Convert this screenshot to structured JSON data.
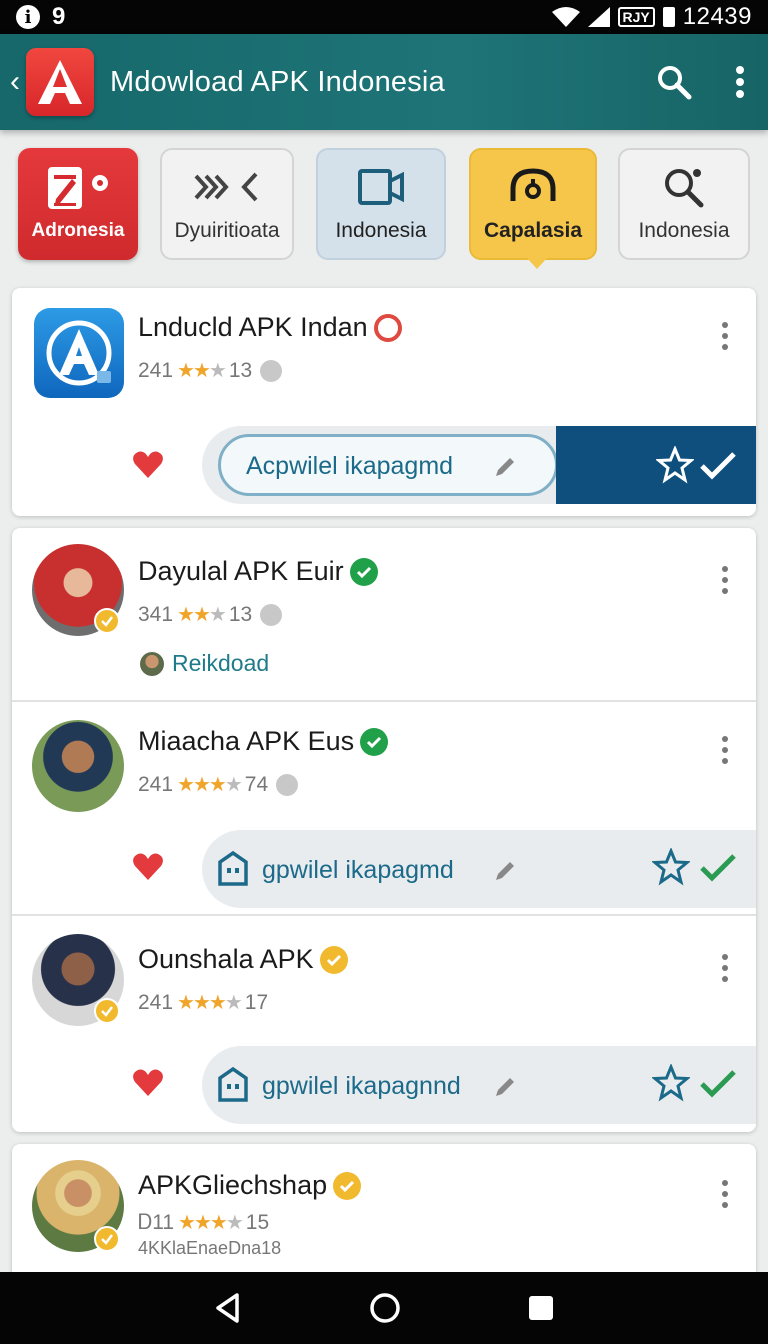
{
  "status_bar": {
    "left_glyph_1": "i",
    "left_glyph_2": "9",
    "network_badge": "RJY",
    "time": "12439"
  },
  "app_bar": {
    "title": "Mdowload APK Indonesia",
    "back_glyph": "‹",
    "logo_letter": "A"
  },
  "categories": [
    {
      "label": "Adronesia",
      "icon": "edit-settings-icon"
    },
    {
      "label": "Dyuiritioata",
      "icon": "chevrons-icon"
    },
    {
      "label": "Indonesia",
      "icon": "video-camera-icon"
    },
    {
      "label": "Capalasia",
      "icon": "headset-icon",
      "selected": true
    },
    {
      "label": "Indonesia",
      "icon": "magnifier-icon"
    }
  ],
  "items": [
    {
      "title": "Lnducld APK Indan",
      "rating_left": "241",
      "stars": 2,
      "rating_right": "13",
      "field_text": "Acpwilel ikapagmd"
    },
    {
      "title": "Dayulal APK Euir",
      "rating_left": "341",
      "stars": 2,
      "rating_right": "13",
      "link_text": "Reikdoad"
    },
    {
      "title": "Miaacha APK Eus",
      "rating_left": "241",
      "stars": 3,
      "rating_right": "74",
      "field_text": "gpwilel ikapagmd"
    },
    {
      "title": "Ounshala APK",
      "rating_left": "241",
      "stars": 3,
      "rating_right": "17",
      "field_text": "gpwilel ikapagnnd"
    },
    {
      "title": "APKGliechshap",
      "rating_left": "Ꭰ11",
      "stars": 3,
      "rating_right": "15",
      "subtitle": "4KKlaEnaeDna18"
    }
  ],
  "colors": {
    "app_bar": "#1e7477",
    "accent_red": "#e5393c",
    "accent_yellow": "#f6c64b",
    "action_dark": "#0e4f7e",
    "star": "#f0a52a"
  }
}
